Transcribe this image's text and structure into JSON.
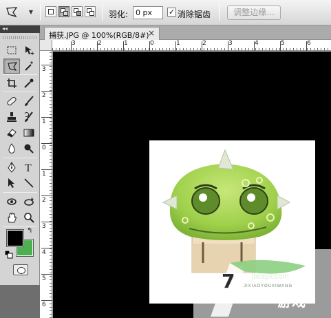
{
  "options_bar": {
    "tool_preset_icon": "polygonal-lasso-icon",
    "selection_modes": [
      "new-selection-icon",
      "add-to-selection-icon",
      "subtract-from-selection-icon",
      "intersect-selection-icon"
    ],
    "active_mode": "add-to-selection-icon",
    "feather_label": "羽化:",
    "feather_value": "0 px",
    "antialias_checked": true,
    "antialias_check_mark": "✓",
    "antialias_label": "消除锯齿",
    "refine_edge_label": "调整边缘..."
  },
  "panel_header": {
    "collapse_glyph": "◂◂"
  },
  "document": {
    "tab_title": "捕获.JPG @ 100%(RGB/8#)",
    "close_glyph": "×"
  },
  "ruler_h_ticks": [
    "3",
    "2",
    "1",
    "0",
    "1",
    "2",
    "3",
    "4",
    "5",
    "6"
  ],
  "ruler_v_ticks": [
    "3",
    "2",
    "1",
    "0",
    "1",
    "2",
    "3",
    "4",
    "5",
    "6"
  ],
  "tools": {
    "selected": "polygonal-lasso-tool",
    "swap_glyph": "↰",
    "foreground_color": "#000000",
    "background_color": "#4caf50"
  },
  "watermark": {
    "number": "7",
    "site_url": "jixiayx.com",
    "sub_text": "JIXIAOYOUXIWANG",
    "label": "游戏"
  }
}
